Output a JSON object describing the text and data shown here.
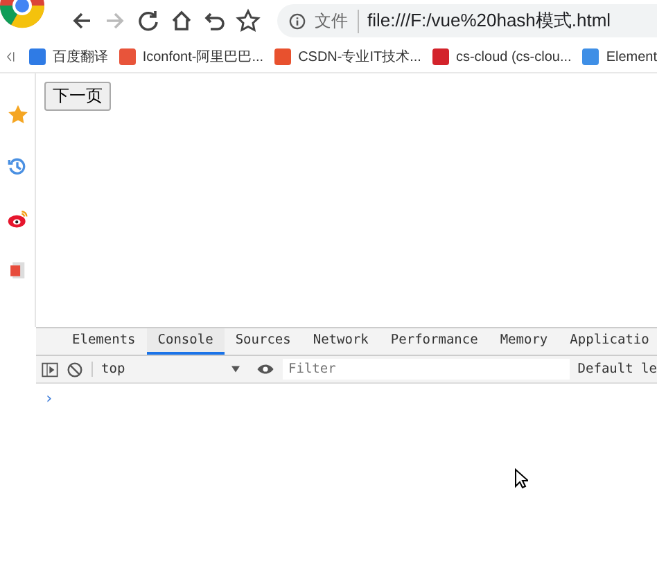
{
  "toolbar": {
    "address": {
      "security_label": "文件",
      "url": "file:///F:/vue%20hash模式.html"
    }
  },
  "bookmarks": [
    {
      "label": "百度翻译",
      "color": "#2f7be5"
    },
    {
      "label": "Iconfont-阿里巴巴...",
      "color": "#e8543a"
    },
    {
      "label": "CSDN-专业IT技术...",
      "color": "#e8512e"
    },
    {
      "label": "cs-cloud (cs-clou...",
      "color": "#d3232b"
    },
    {
      "label": "Element",
      "color": "#3f8fe6"
    }
  ],
  "page": {
    "button": "下一页"
  },
  "devtools": {
    "tabs": [
      {
        "label": "Elements",
        "selected": false
      },
      {
        "label": "Console",
        "selected": true
      },
      {
        "label": "Sources",
        "selected": false
      },
      {
        "label": "Network",
        "selected": false
      },
      {
        "label": "Performance",
        "selected": false
      },
      {
        "label": "Memory",
        "selected": false
      },
      {
        "label": "Applicatio",
        "selected": false
      }
    ],
    "context": "top",
    "filter": {
      "placeholder": "Filter"
    },
    "levels": "Default le",
    "prompt": "›"
  }
}
